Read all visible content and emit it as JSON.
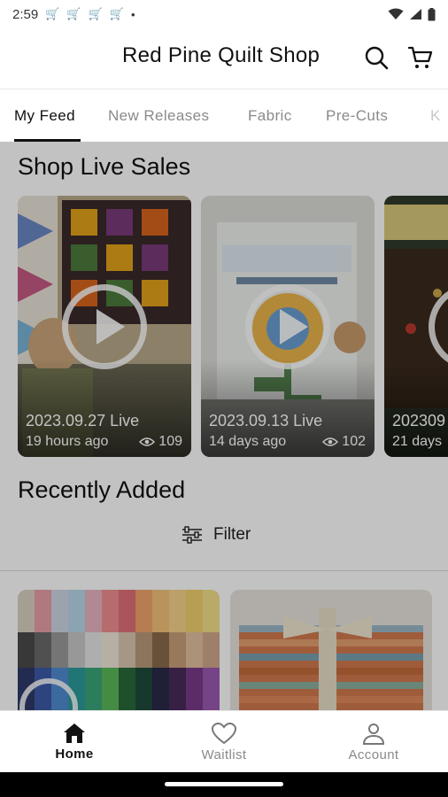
{
  "status_bar": {
    "time": "2:59",
    "dot": "•"
  },
  "header": {
    "title": "Red Pine Quilt Shop",
    "icons": [
      "search-icon",
      "cart-icon"
    ]
  },
  "tabs": [
    {
      "label": "My Feed",
      "active": true
    },
    {
      "label": "New Releases",
      "active": false
    },
    {
      "label": "Fabric",
      "active": false
    },
    {
      "label": "Pre-Cuts",
      "active": false
    },
    {
      "label": "K",
      "active": false
    }
  ],
  "live_sales": {
    "title": "Shop Live Sales",
    "cards": [
      {
        "title": "2023.09.27 Live",
        "ago": "19 hours ago",
        "views": "109"
      },
      {
        "title": "2023.09.13 Live",
        "ago": "14 days ago",
        "views": "102"
      },
      {
        "title": "202309",
        "ago": "21 days"
      }
    ]
  },
  "recently_added": {
    "title": "Recently Added",
    "filter_label": "Filter"
  },
  "bottom_nav": [
    {
      "label": "Home",
      "icon": "home-icon",
      "active": true
    },
    {
      "label": "Waitlist",
      "icon": "heart-icon",
      "active": false
    },
    {
      "label": "Account",
      "icon": "account-icon",
      "active": false
    }
  ],
  "colors": {
    "overlay": "#000000",
    "active": "#111111",
    "inactive": "#8a8a8a"
  }
}
